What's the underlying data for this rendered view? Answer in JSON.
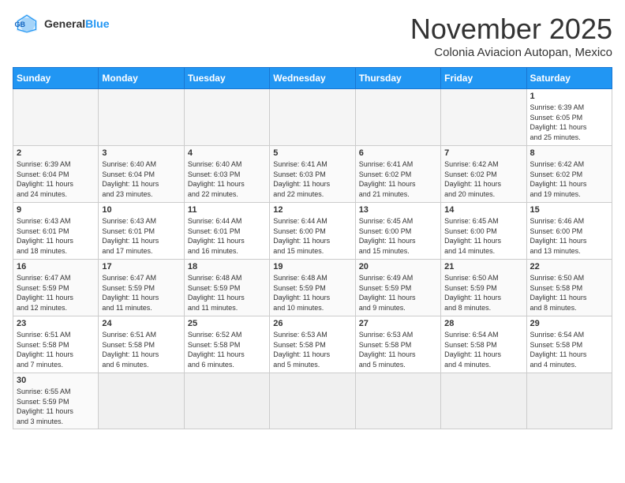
{
  "header": {
    "logo_general": "General",
    "logo_blue": "Blue",
    "title": "November 2025",
    "subtitle": "Colonia Aviacion Autopan, Mexico"
  },
  "days_of_week": [
    "Sunday",
    "Monday",
    "Tuesday",
    "Wednesday",
    "Thursday",
    "Friday",
    "Saturday"
  ],
  "weeks": [
    [
      {
        "num": "",
        "info": ""
      },
      {
        "num": "",
        "info": ""
      },
      {
        "num": "",
        "info": ""
      },
      {
        "num": "",
        "info": ""
      },
      {
        "num": "",
        "info": ""
      },
      {
        "num": "",
        "info": ""
      },
      {
        "num": "1",
        "info": "Sunrise: 6:39 AM\nSunset: 6:05 PM\nDaylight: 11 hours\nand 25 minutes."
      }
    ],
    [
      {
        "num": "2",
        "info": "Sunrise: 6:39 AM\nSunset: 6:04 PM\nDaylight: 11 hours\nand 24 minutes."
      },
      {
        "num": "3",
        "info": "Sunrise: 6:40 AM\nSunset: 6:04 PM\nDaylight: 11 hours\nand 23 minutes."
      },
      {
        "num": "4",
        "info": "Sunrise: 6:40 AM\nSunset: 6:03 PM\nDaylight: 11 hours\nand 22 minutes."
      },
      {
        "num": "5",
        "info": "Sunrise: 6:41 AM\nSunset: 6:03 PM\nDaylight: 11 hours\nand 22 minutes."
      },
      {
        "num": "6",
        "info": "Sunrise: 6:41 AM\nSunset: 6:02 PM\nDaylight: 11 hours\nand 21 minutes."
      },
      {
        "num": "7",
        "info": "Sunrise: 6:42 AM\nSunset: 6:02 PM\nDaylight: 11 hours\nand 20 minutes."
      },
      {
        "num": "8",
        "info": "Sunrise: 6:42 AM\nSunset: 6:02 PM\nDaylight: 11 hours\nand 19 minutes."
      }
    ],
    [
      {
        "num": "9",
        "info": "Sunrise: 6:43 AM\nSunset: 6:01 PM\nDaylight: 11 hours\nand 18 minutes."
      },
      {
        "num": "10",
        "info": "Sunrise: 6:43 AM\nSunset: 6:01 PM\nDaylight: 11 hours\nand 17 minutes."
      },
      {
        "num": "11",
        "info": "Sunrise: 6:44 AM\nSunset: 6:01 PM\nDaylight: 11 hours\nand 16 minutes."
      },
      {
        "num": "12",
        "info": "Sunrise: 6:44 AM\nSunset: 6:00 PM\nDaylight: 11 hours\nand 15 minutes."
      },
      {
        "num": "13",
        "info": "Sunrise: 6:45 AM\nSunset: 6:00 PM\nDaylight: 11 hours\nand 15 minutes."
      },
      {
        "num": "14",
        "info": "Sunrise: 6:45 AM\nSunset: 6:00 PM\nDaylight: 11 hours\nand 14 minutes."
      },
      {
        "num": "15",
        "info": "Sunrise: 6:46 AM\nSunset: 6:00 PM\nDaylight: 11 hours\nand 13 minutes."
      }
    ],
    [
      {
        "num": "16",
        "info": "Sunrise: 6:47 AM\nSunset: 5:59 PM\nDaylight: 11 hours\nand 12 minutes."
      },
      {
        "num": "17",
        "info": "Sunrise: 6:47 AM\nSunset: 5:59 PM\nDaylight: 11 hours\nand 11 minutes."
      },
      {
        "num": "18",
        "info": "Sunrise: 6:48 AM\nSunset: 5:59 PM\nDaylight: 11 hours\nand 11 minutes."
      },
      {
        "num": "19",
        "info": "Sunrise: 6:48 AM\nSunset: 5:59 PM\nDaylight: 11 hours\nand 10 minutes."
      },
      {
        "num": "20",
        "info": "Sunrise: 6:49 AM\nSunset: 5:59 PM\nDaylight: 11 hours\nand 9 minutes."
      },
      {
        "num": "21",
        "info": "Sunrise: 6:50 AM\nSunset: 5:59 PM\nDaylight: 11 hours\nand 8 minutes."
      },
      {
        "num": "22",
        "info": "Sunrise: 6:50 AM\nSunset: 5:58 PM\nDaylight: 11 hours\nand 8 minutes."
      }
    ],
    [
      {
        "num": "23",
        "info": "Sunrise: 6:51 AM\nSunset: 5:58 PM\nDaylight: 11 hours\nand 7 minutes."
      },
      {
        "num": "24",
        "info": "Sunrise: 6:51 AM\nSunset: 5:58 PM\nDaylight: 11 hours\nand 6 minutes."
      },
      {
        "num": "25",
        "info": "Sunrise: 6:52 AM\nSunset: 5:58 PM\nDaylight: 11 hours\nand 6 minutes."
      },
      {
        "num": "26",
        "info": "Sunrise: 6:53 AM\nSunset: 5:58 PM\nDaylight: 11 hours\nand 5 minutes."
      },
      {
        "num": "27",
        "info": "Sunrise: 6:53 AM\nSunset: 5:58 PM\nDaylight: 11 hours\nand 5 minutes."
      },
      {
        "num": "28",
        "info": "Sunrise: 6:54 AM\nSunset: 5:58 PM\nDaylight: 11 hours\nand 4 minutes."
      },
      {
        "num": "29",
        "info": "Sunrise: 6:54 AM\nSunset: 5:58 PM\nDaylight: 11 hours\nand 4 minutes."
      }
    ],
    [
      {
        "num": "30",
        "info": "Sunrise: 6:55 AM\nSunset: 5:59 PM\nDaylight: 11 hours\nand 3 minutes."
      },
      {
        "num": "",
        "info": ""
      },
      {
        "num": "",
        "info": ""
      },
      {
        "num": "",
        "info": ""
      },
      {
        "num": "",
        "info": ""
      },
      {
        "num": "",
        "info": ""
      },
      {
        "num": "",
        "info": ""
      }
    ]
  ]
}
